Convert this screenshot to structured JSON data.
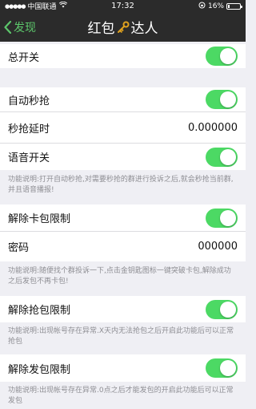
{
  "status": {
    "carrier": "中国联通",
    "time": "17:32",
    "battery": "16%",
    "battery_level": 0.16
  },
  "nav": {
    "back_label": "发现",
    "title_part1": "红包",
    "title_part2": "达人",
    "title_icon": "key-icon"
  },
  "settings": {
    "master_switch": {
      "label": "总开关",
      "on": true
    },
    "auto_grab": {
      "label": "自动秒抢",
      "on": true
    },
    "grab_delay": {
      "label": "秒抢延时",
      "value": "0.000000"
    },
    "voice_switch": {
      "label": "语音开关",
      "on": true
    },
    "note1": "功能说明:打开自动秒抢,对需要秒抢的群进行投诉之后,就会秒抢当前群,并且语音播报!",
    "unlock_card": {
      "label": "解除卡包限制",
      "on": true
    },
    "password": {
      "label": "密码",
      "value": "000000"
    },
    "note2": "功能说明:随便找个群投诉一下,点击金钥匙图标一键突破卡包,解除成功之后发包不再卡包!",
    "unlock_grab": {
      "label": "解除抢包限制",
      "on": true
    },
    "note3": "功能说明:出现帐号存在异常.X天内无法抢包之后开启此功能后可以正常抢包",
    "unlock_send": {
      "label": "解除发包限制",
      "on": true
    },
    "note4": "功能说明:出现帐号存在异常.0点之后才能发包的开启此功能后可以正常发包"
  },
  "colors": {
    "toggle_on": "#4cd964",
    "back_accent": "#5cc66b",
    "nav_bg": "#2b2b2b",
    "key_gold": "#e0a21e"
  }
}
